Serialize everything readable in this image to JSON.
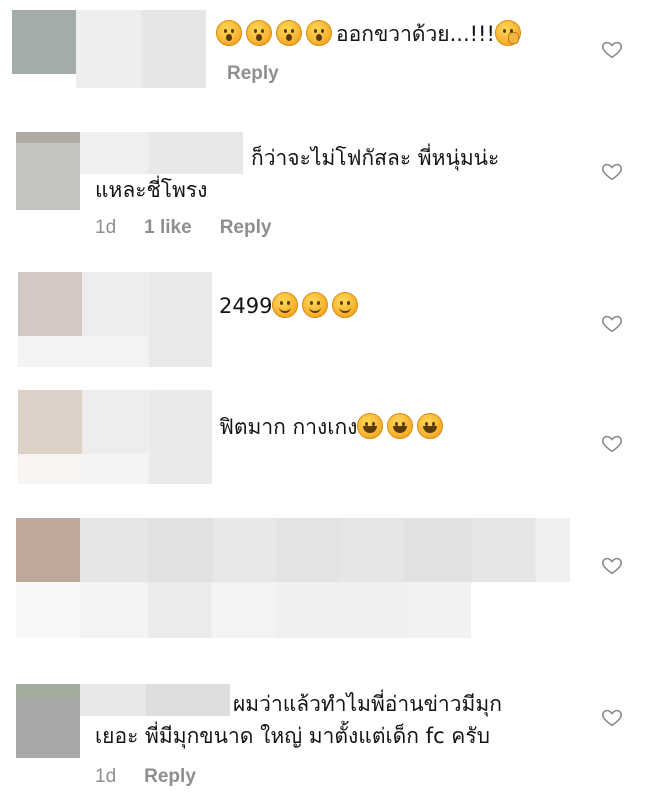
{
  "comments": [
    {
      "text_line1": "ออกขวาด้วย...!!!",
      "text_line2": "",
      "emojis_before": [
        "astonished-emoji",
        "astonished-emoji",
        "astonished-emoji",
        "astonished-emoji"
      ],
      "emojis_after": [
        "face-with-hand-over-mouth-emoji"
      ],
      "time": "",
      "likes": "",
      "reply": "Reply"
    },
    {
      "text_line1": "ก็ว่าจะไม่โฟกัสละ พี่หนุ่มน่ะ",
      "text_line2": "แหละชี่โพรง",
      "time": "1d",
      "likes": "1 like",
      "reply": "Reply"
    },
    {
      "text_line1": "2499",
      "emojis_after": [
        "smiling-face-emoji",
        "smiling-face-emoji",
        "smiling-face-emoji"
      ]
    },
    {
      "text_line1": "ฟิตมาก กางเกง",
      "emojis_after": [
        "tears-of-joy-emoji",
        "tears-of-joy-emoji",
        "tears-of-joy-emoji"
      ]
    },
    {
      "text_line1": ""
    },
    {
      "text_line1": "ผมว่าแล้วทำไมพี่อ่านข่าวมีมุก",
      "text_line2": "เยอะ พี่มีมุกขนาด ใหญ่ มาตั้งแต่เด็ก fc ครับ",
      "time": "1d",
      "reply": "Reply"
    }
  ],
  "colors": {
    "meta_gray": "#8e8e8e",
    "heart_outline": "#8e8e8e"
  },
  "icons": {
    "like": "heart-outline-icon"
  }
}
